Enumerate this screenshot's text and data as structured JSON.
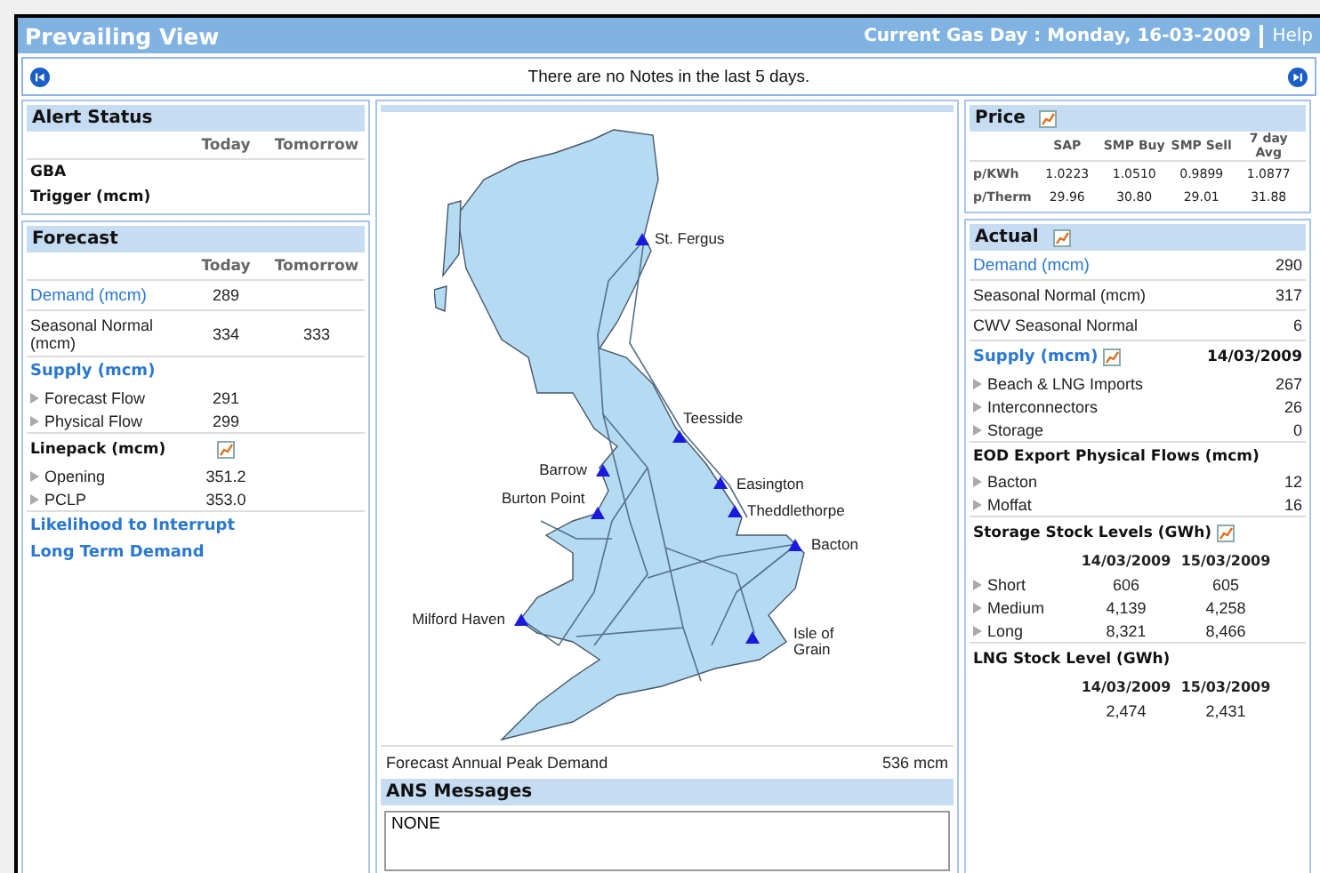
{
  "header": {
    "title": "Prevailing View",
    "gas_day": "Current Gas Day : Monday, 16-03-2009",
    "help": "Help"
  },
  "notes": {
    "text": "There are no Notes in the last 5 days."
  },
  "alert_status": {
    "title": "Alert Status",
    "columns": [
      "Today",
      "Tomorrow"
    ],
    "rows": [
      {
        "label": "GBA"
      },
      {
        "label": "Trigger (mcm)"
      }
    ]
  },
  "forecast": {
    "title": "Forecast",
    "columns": [
      "Today",
      "Tomorrow"
    ],
    "rows": [
      {
        "label": "Demand (mcm)",
        "today": "289",
        "kind": "link"
      },
      {
        "label": "Seasonal Normal (mcm)",
        "today": "334",
        "tomorrow": "333",
        "kind": "plain"
      }
    ],
    "supply": {
      "label": "Supply (mcm)",
      "rows": [
        {
          "label": "Forecast Flow",
          "today": "291"
        },
        {
          "label": "Physical Flow",
          "today": "299"
        }
      ]
    },
    "linepack": {
      "label": "Linepack (mcm)",
      "rows": [
        {
          "label": "Opening",
          "today": "351.2"
        },
        {
          "label": "PCLP",
          "today": "353.0"
        }
      ]
    },
    "links": [
      "Likelihood to Interrupt",
      "Long Term Demand"
    ]
  },
  "map": {
    "terminals": [
      {
        "name": "St. Fergus"
      },
      {
        "name": "Teesside"
      },
      {
        "name": "Barrow"
      },
      {
        "name": "Easington"
      },
      {
        "name": "Burton Point"
      },
      {
        "name": "Theddlethorpe"
      },
      {
        "name": "Bacton"
      },
      {
        "name": "Milford Haven"
      },
      {
        "name": "Isle of Grain"
      }
    ],
    "peak_label": "Forecast Annual Peak Demand",
    "peak_value": "536 mcm"
  },
  "ans": {
    "title": "ANS Messages",
    "text": "NONE"
  },
  "price": {
    "title": "Price",
    "columns": [
      "SAP",
      "SMP Buy",
      "SMP Sell",
      "7 day Avg"
    ],
    "rows": [
      {
        "label": "p/KWh",
        "values": [
          "1.0223",
          "1.0510",
          "0.9899",
          "1.0877"
        ]
      },
      {
        "label": "p/Therm",
        "values": [
          "29.96",
          "30.80",
          "29.01",
          "31.88"
        ]
      }
    ]
  },
  "actual": {
    "title": "Actual",
    "rows": [
      {
        "label": "Demand (mcm)",
        "value": "290",
        "kind": "link"
      },
      {
        "label": "Seasonal Normal (mcm)",
        "value": "317",
        "kind": "plain"
      },
      {
        "label": "CWV Seasonal Normal",
        "value": "6",
        "kind": "plain"
      }
    ],
    "supply": {
      "label": "Supply (mcm)",
      "date": "14/03/2009",
      "rows": [
        {
          "label": "Beach & LNG Imports",
          "value": "267"
        },
        {
          "label": "Interconnectors",
          "value": "26"
        },
        {
          "label": "Storage",
          "value": "0"
        }
      ]
    },
    "eod": {
      "title": "EOD Export Physical Flows (mcm)",
      "rows": [
        {
          "label": "Bacton",
          "value": "12"
        },
        {
          "label": "Moffat",
          "value": "16"
        }
      ]
    },
    "storage": {
      "title": "Storage Stock Levels (GWh)",
      "columns": [
        "14/03/2009",
        "15/03/2009"
      ],
      "rows": [
        {
          "label": "Short",
          "values": [
            "606",
            "605"
          ]
        },
        {
          "label": "Medium",
          "values": [
            "4,139",
            "4,258"
          ]
        },
        {
          "label": "Long",
          "values": [
            "8,321",
            "8,466"
          ]
        }
      ]
    },
    "lng": {
      "title": "LNG Stock Level (GWh)",
      "columns": [
        "14/03/2009",
        "15/03/2009"
      ],
      "values": [
        "2,474",
        "2,431"
      ]
    }
  }
}
